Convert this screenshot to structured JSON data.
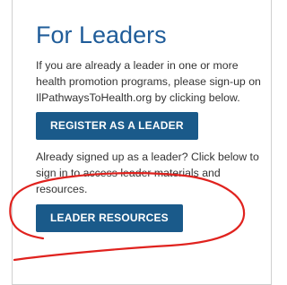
{
  "leaders": {
    "title": "For Leaders",
    "intro_lines": [
      "If you are already a leader in one or more",
      "health promotion programs, please sign-up on",
      "IlPathwaysToHealth.org by clicking below."
    ],
    "register_label": "REGISTER AS A LEADER",
    "signed_lines": [
      "Already signed up as a leader? Click below to",
      "sign in to access leader materials and",
      "resources."
    ],
    "resources_label": "LEADER RESOURCES"
  },
  "annotation": {
    "color": "#e0221e"
  }
}
